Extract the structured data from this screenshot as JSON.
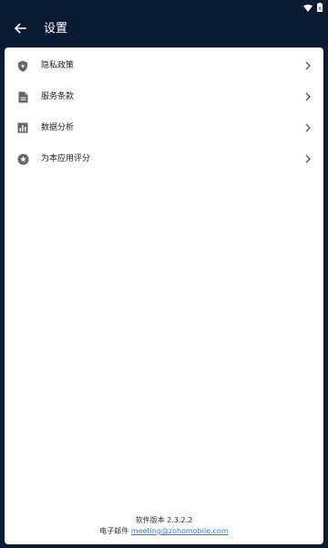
{
  "colors": {
    "header_bg": "#0b1a33",
    "card_bg": "#ffffff",
    "icon_gray": "#666666",
    "link": "#2e7bd6"
  },
  "status_bar": {
    "icons": [
      "wifi-icon",
      "battery-icon"
    ]
  },
  "header": {
    "back_icon": "arrow-left-icon",
    "title": "设置"
  },
  "menu": {
    "items": [
      {
        "icon": "shield-icon",
        "label": "隐私政策"
      },
      {
        "icon": "document-icon",
        "label": "服务条款"
      },
      {
        "icon": "bar-chart-icon",
        "label": "数据分析"
      },
      {
        "icon": "star-icon",
        "label": "为本应用评分"
      }
    ]
  },
  "footer": {
    "version": "软件版本 2.3.2.2",
    "email_label": "电子邮件",
    "email": "meeting@zohomobile.com"
  }
}
